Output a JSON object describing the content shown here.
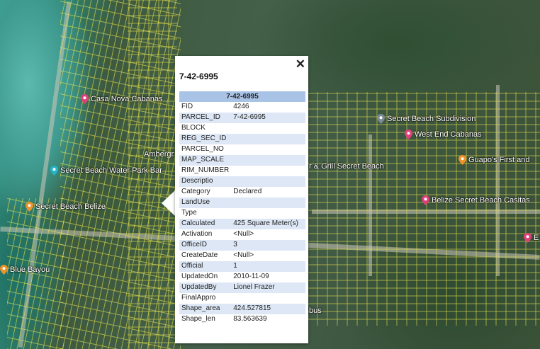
{
  "map": {
    "pois": [
      {
        "label": "Casa Nova Cabanas",
        "color": "#e0407a"
      },
      {
        "label": "Secret Beach Subdivision",
        "color": "#7b8a95"
      },
      {
        "label": "West End Cabanas",
        "color": "#e0407a"
      },
      {
        "label": "Ambergr",
        "color": "none"
      },
      {
        "label": "Secret Beach Water Park Bar",
        "color": "#27b3c9"
      },
      {
        "label": "r & Grill Secret Beach",
        "color": "none"
      },
      {
        "label": "Guapo's First and",
        "color": "#f0922a"
      },
      {
        "label": "Belize Secret Beach Casitas",
        "color": "#e0407a"
      },
      {
        "label": "Secret Beach Belize",
        "color": "#f0922a"
      },
      {
        "label": "Blue Bayou",
        "color": "#f0922a"
      },
      {
        "label": "E",
        "color": "#e0407a"
      },
      {
        "label": "bus",
        "color": "none"
      }
    ]
  },
  "popup": {
    "close_label": "✕",
    "title": "7-42-6995",
    "table_header": "7-42-6995",
    "rows": [
      {
        "key": "FID",
        "value": "4246"
      },
      {
        "key": "PARCEL_ID",
        "value": "7-42-6995"
      },
      {
        "key": "BLOCK",
        "value": ""
      },
      {
        "key": "REG_SEC_ID",
        "value": ""
      },
      {
        "key": "PARCEL_NO",
        "value": ""
      },
      {
        "key": "MAP_SCALE",
        "value": ""
      },
      {
        "key": "RIM_NUMBER",
        "value": ""
      },
      {
        "key": "Descriptio",
        "value": ""
      },
      {
        "key": "Category",
        "value": "Declared"
      },
      {
        "key": "LandUse",
        "value": ""
      },
      {
        "key": "Type",
        "value": ""
      },
      {
        "key": "Calculated",
        "value": "425 Square Meter(s)"
      },
      {
        "key": "Activation",
        "value": "<Null>"
      },
      {
        "key": "OfficeID",
        "value": "3"
      },
      {
        "key": "CreateDate",
        "value": "<Null>"
      },
      {
        "key": "Official",
        "value": "1"
      },
      {
        "key": "UpdatedOn",
        "value": "2010-11-09"
      },
      {
        "key": "UpdatedBy",
        "value": "Lionel Frazer"
      },
      {
        "key": "FinalAppro",
        "value": ""
      },
      {
        "key": "Shape_area",
        "value": "424.527815"
      },
      {
        "key": "Shape_len",
        "value": "83.563639"
      }
    ]
  }
}
